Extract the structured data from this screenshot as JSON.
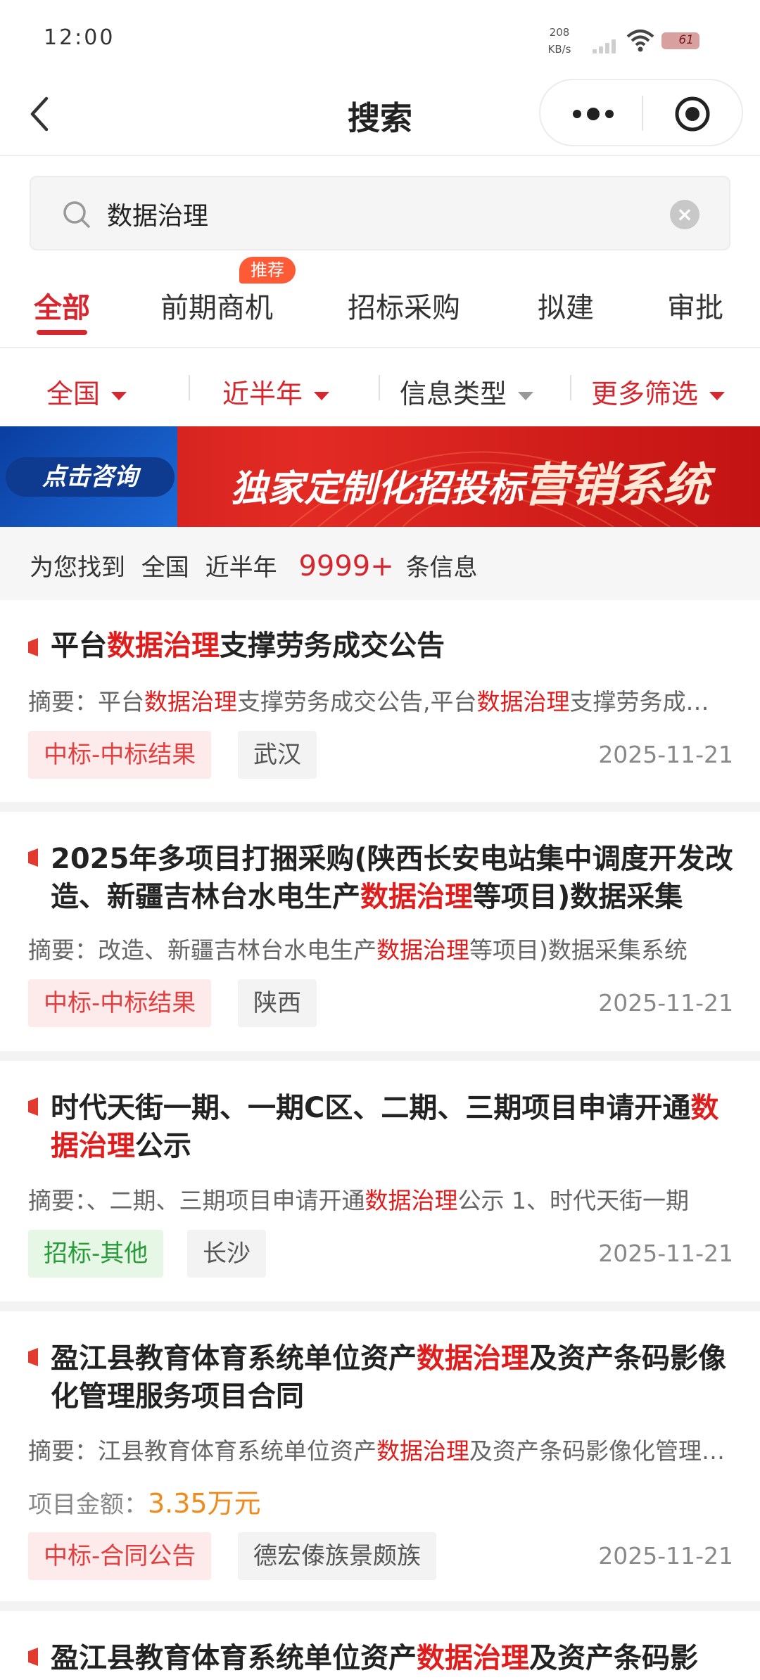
{
  "status_bar": {
    "time": "12:00",
    "net_speed_value": "208",
    "net_speed_unit": "KB/s",
    "battery": "61"
  },
  "nav": {
    "title": "搜索"
  },
  "search": {
    "query": "数据治理"
  },
  "tabs": [
    {
      "label": "全部",
      "active": true
    },
    {
      "label": "前期商机",
      "badge": "推荐"
    },
    {
      "label": "招标采购"
    },
    {
      "label": "拟建"
    },
    {
      "label": "审批"
    }
  ],
  "filters": [
    {
      "label": "全国"
    },
    {
      "label": "近半年"
    },
    {
      "label": "信息类型"
    },
    {
      "label": "更多筛选"
    }
  ],
  "banner": {
    "button": "点击咨询",
    "text_small": "独家定制化招投标",
    "text_big": "营销系统"
  },
  "summary": {
    "prefix": "为您找到",
    "region": "全国",
    "period": "近半年",
    "count": "9999+",
    "suffix": "条信息"
  },
  "results": [
    {
      "title_parts": [
        "平台",
        "数据治理",
        "支撑劳务成交公告"
      ],
      "abstract_label": "摘要：",
      "abstract_parts": [
        "平台",
        "数据治理",
        "支撑劳务成交公告,平台",
        "数据治理",
        "支撑劳务成交公告"
      ],
      "tags": [
        "中标-中标结果",
        "武汉"
      ],
      "date": "2025-11-21"
    },
    {
      "title_parts": [
        "2025年多项目打捆采购(陕西长安电站集中调度开发改造、新疆吉林台水电生产",
        "数据治理",
        "等项目)数据采集"
      ],
      "abstract_label": "摘要：",
      "abstract_parts": [
        "改造、新疆吉林台水电生产",
        "数据治理",
        "等项目)数据采集系统"
      ],
      "tags": [
        "中标-中标结果",
        "陕西"
      ],
      "date": "2025-11-21"
    },
    {
      "title_parts": [
        "时代天街一期、一期C区、二期、三期项目申请开通",
        "数据治理",
        "公示"
      ],
      "abstract_label": "摘要：",
      "abstract_parts": [
        "、二期、三期项目申请开通",
        "数据治理",
        "公示 1、时代天街一期"
      ],
      "tags": [
        "招标-其他",
        "长沙"
      ],
      "date": "2025-11-21"
    },
    {
      "title_parts": [
        "盈江县教育体育系统单位资产",
        "数据治理",
        "及资产条码影像化管理服务项目合同"
      ],
      "abstract_label": "摘要：",
      "abstract_parts": [
        "江县教育体育系统单位资产",
        "数据治理",
        "及资产条码影像化管理服务项目"
      ],
      "amount_label": "项目金额：",
      "amount_value": "3.35万元",
      "tags": [
        "中标-合同公告",
        "德宏傣族景颇族"
      ],
      "date": "2025-11-21"
    },
    {
      "title_parts": [
        "盈江县教育体育系统单位资产",
        "数据治理",
        "及资产条码影"
      ]
    }
  ],
  "colors": {
    "accent": "#d7262d",
    "highlight": "#e01d1d",
    "amount": "#f08a1c"
  }
}
